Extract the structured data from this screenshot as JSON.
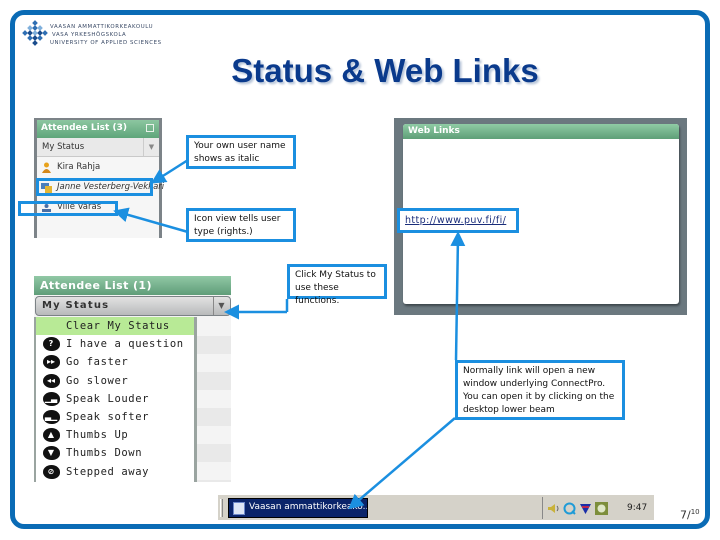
{
  "logo": {
    "line1": "VAASAN AMMATTIKORKEAKOULU",
    "line2": "VASA YRKESHÖGSKOLA",
    "line3": "UNIVERSITY OF APPLIED SCIENCES"
  },
  "slide": {
    "title": "Status & Web Links",
    "page_number": "7",
    "page_total": "10"
  },
  "attendee_small": {
    "header": "Attendee List (3)",
    "status_label": "My Status",
    "attendees": [
      {
        "name": "Kira Rahja",
        "icon": "host-icon",
        "italic": false
      },
      {
        "name": "Janne Vesterberg-Vekkari",
        "icon": "presenter-icon",
        "italic": true
      },
      {
        "name": "Ville Varas",
        "icon": "participant-icon",
        "italic": false
      }
    ]
  },
  "callouts": {
    "own_name": "Your own user name shows as italic",
    "icon_view": "Icon view tells user type (rights.)",
    "click_status": "Click My Status to use these functions.",
    "link_note": "Normally link will open a new window underlying ConnectPro. You can open it by clicking on the desktop lower beam"
  },
  "web_links": {
    "header": "Web Links",
    "link": "http://www.puv.fi/fi/"
  },
  "attendee_big": {
    "header": "Attendee List (1)",
    "status_label": "My Status",
    "menu": [
      {
        "label": "Clear My Status",
        "icon": ""
      },
      {
        "label": "I have a question",
        "icon": "question-icon",
        "glyph": "?"
      },
      {
        "label": "Go faster",
        "icon": "go-faster-icon",
        "glyph": "▸▸"
      },
      {
        "label": "Go slower",
        "icon": "go-slower-icon",
        "glyph": "◂◂"
      },
      {
        "label": "Speak Louder",
        "icon": "speak-louder-icon",
        "glyph": "▁▃"
      },
      {
        "label": "Speak softer",
        "icon": "speak-softer-icon",
        "glyph": "▃▁"
      },
      {
        "label": "Thumbs Up",
        "icon": "thumbs-up-icon",
        "glyph": "▲"
      },
      {
        "label": "Thumbs Down",
        "icon": "thumbs-down-icon",
        "glyph": "▼"
      },
      {
        "label": "Stepped away",
        "icon": "stepped-away-icon",
        "glyph": "⊘"
      }
    ]
  },
  "taskbar": {
    "task_label": "Vaasan ammattikorkeako...",
    "time": "9:47"
  },
  "colors": {
    "frame_blue": "#0a6bb5",
    "callout_blue": "#1b8fe0",
    "title_navy": "#0a3a8c",
    "panel_green": "#5ea57a",
    "menu_highlight": "#b8ea96"
  }
}
